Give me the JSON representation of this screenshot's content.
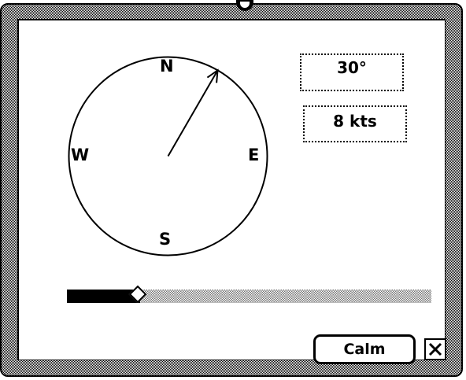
{
  "dialog": {
    "title": ""
  },
  "compass": {
    "heading_degrees": 30,
    "labels": {
      "north": "N",
      "east": "E",
      "south": "S",
      "west": "W"
    }
  },
  "readouts": {
    "direction": "30°",
    "speed": "8 kts"
  },
  "slider": {
    "level_fraction": 0.2
  },
  "buttons": {
    "calm_label": "Calm"
  },
  "icons": {
    "close": "close-icon",
    "needle": "arrow-icon",
    "knob": "diamond-icon"
  },
  "colors": {
    "ink": "#000000",
    "paper": "#ffffff"
  }
}
